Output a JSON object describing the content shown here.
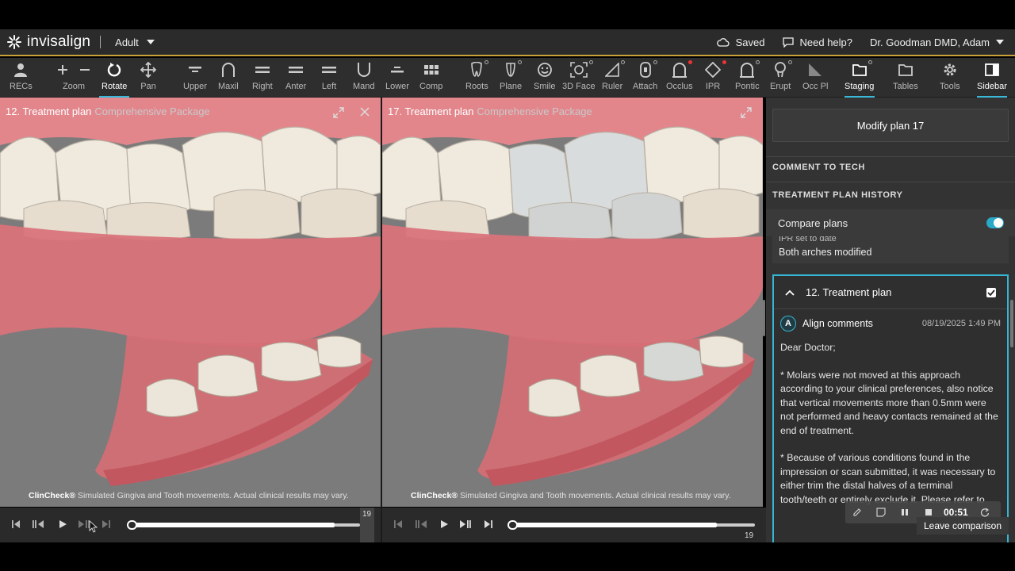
{
  "header": {
    "brand": "invisalign",
    "mode": "Adult",
    "saved": "Saved",
    "help": "Need help?",
    "user": "Dr. Goodman DMD, Adam"
  },
  "toolbar": {
    "recs": "RECs",
    "zoom": "Zoom",
    "rotate": "Rotate",
    "pan": "Pan",
    "upper": "Upper",
    "maxil": "Maxil",
    "right": "Right",
    "anter": "Anter",
    "left": "Left",
    "mand": "Mand",
    "lower": "Lower",
    "comp": "Comp",
    "roots": "Roots",
    "plane": "Plane",
    "smile": "Smile",
    "face3d": "3D Face",
    "ruler": "Ruler",
    "attach": "Attach",
    "occlus": "Occlus",
    "ipr": "IPR",
    "pontic": "Pontic",
    "erupt": "Erupt",
    "occpl": "Occ Pl",
    "staging": "Staging",
    "tables": "Tables",
    "tools": "Tools",
    "sidebar": "Sidebar"
  },
  "left_view": {
    "title": "12. Treatment plan",
    "subtitle": "Comprehensive Package",
    "brand": "ClinCheck®",
    "disclaimer": "Simulated Gingiva and Tooth movements. Actual clinical results may vary.",
    "step": "19"
  },
  "right_view": {
    "title": "17. Treatment plan",
    "subtitle": "Comprehensive Package",
    "brand": "ClinCheck®",
    "disclaimer": "Simulated Gingiva and Tooth movements. Actual clinical results may vary.",
    "step": "19"
  },
  "sidebar": {
    "modify_button": "Modify plan 17",
    "comment_to_tech": "COMMENT TO TECH",
    "history": "TREATMENT PLAN HISTORY",
    "compare_plans": "Compare plans",
    "prev_clip": "IPR set to date",
    "prev_text": "Both arches modified",
    "plan_title": "12. Treatment plan",
    "comment_author": "Align comments",
    "comment_avatar": "A",
    "comment_date": "08/19/2025 1:49 PM",
    "comment_p1": "Dear Doctor;",
    "comment_p2": "* Molars were not moved at this approach according to your clinical preferences, also notice that vertical movements more than 0.5mm were not performed and heavy contacts remained at the end of treatment.",
    "comment_p3": "* Because of various conditions found in the impression or scan submitted, it was necessary to either trim the distal halves of a terminal tooth/teeth or entirely exclude it. Please refer to"
  },
  "recorder": {
    "time": "00:51",
    "leave": "Leave comparison"
  },
  "colors": {
    "accent": "#39b9d9",
    "header_rule": "#c9a13a",
    "gingiva": "#d9737a",
    "tooth": "#ece6da"
  }
}
